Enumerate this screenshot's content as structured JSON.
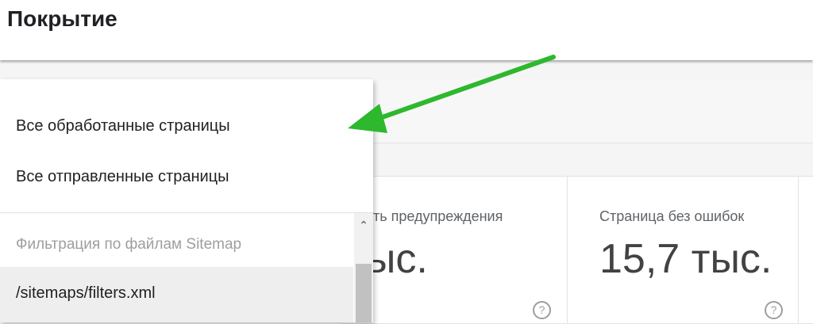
{
  "header": {
    "title": "Покрытие"
  },
  "dropdown": {
    "items": [
      {
        "label": "Все обработанные страницы"
      },
      {
        "label": "Все отправленные страницы"
      }
    ],
    "section_header": "Фильтрация по файлам Sitemap",
    "sitemap_item": "/sitemaps/filters.xml"
  },
  "cards": [
    {
      "label": "сть предупреждения",
      "value": "ыс."
    },
    {
      "label": "Страница без ошибок",
      "value": "15,7 тыс."
    }
  ],
  "help_icon_glyph": "?",
  "scroll_up_glyph": "⌃",
  "colors": {
    "arrow": "#2db82d"
  }
}
